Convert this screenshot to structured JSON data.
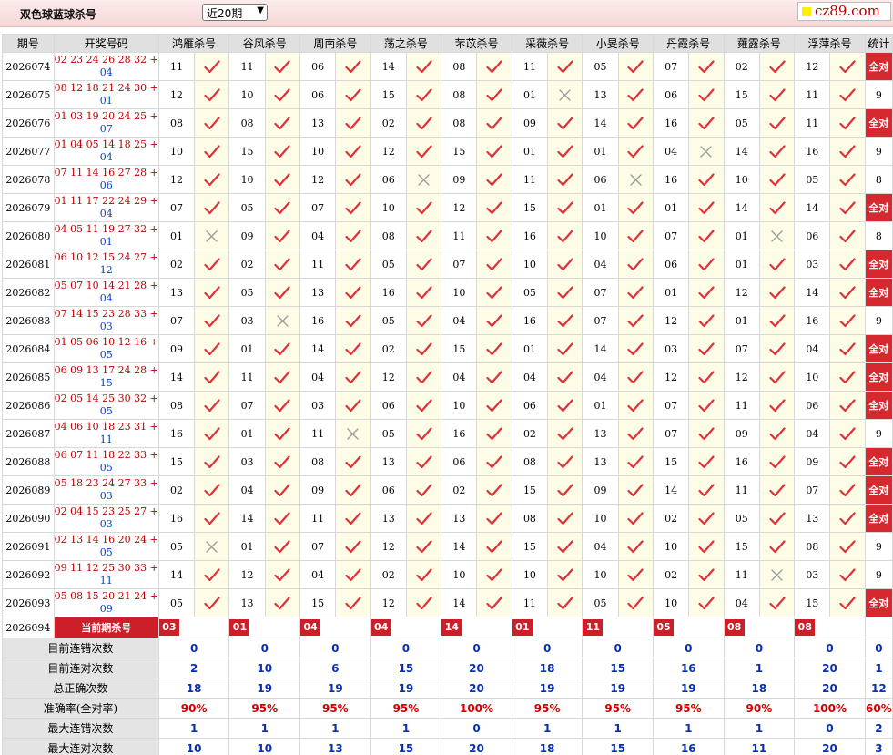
{
  "header": {
    "title": "双色球蓝球杀号",
    "range_select": "近20期",
    "logo": "cz89.com"
  },
  "table": {
    "columns": [
      "期号",
      "开奖号码",
      "鸿雁杀号",
      "谷风杀号",
      "周南杀号",
      "荡之杀号",
      "芣苡杀号",
      "采薇杀号",
      "小旻杀号",
      "丹霞杀号",
      "蕹露杀号",
      "浮萍杀号",
      "统计"
    ],
    "all_right_label": "全对",
    "rows": [
      {
        "period": "2026074",
        "red": "02 23 24 26 28 32 +",
        "blue": "04",
        "kills": [
          [
            "11",
            1
          ],
          [
            "11",
            1
          ],
          [
            "06",
            1
          ],
          [
            "14",
            1
          ],
          [
            "08",
            1
          ],
          [
            "11",
            1
          ],
          [
            "05",
            1
          ],
          [
            "07",
            1
          ],
          [
            "02",
            1
          ],
          [
            "12",
            1
          ]
        ],
        "stat": "全对"
      },
      {
        "period": "2026075",
        "red": "08 12 18 21 24 30 +",
        "blue": "01",
        "kills": [
          [
            "12",
            1
          ],
          [
            "10",
            1
          ],
          [
            "06",
            1
          ],
          [
            "15",
            1
          ],
          [
            "08",
            1
          ],
          [
            "01",
            0
          ],
          [
            "13",
            1
          ],
          [
            "06",
            1
          ],
          [
            "15",
            1
          ],
          [
            "11",
            1
          ]
        ],
        "stat": "9"
      },
      {
        "period": "2026076",
        "red": "01 03 19 20 24 25 +",
        "blue": "07",
        "kills": [
          [
            "08",
            1
          ],
          [
            "08",
            1
          ],
          [
            "13",
            1
          ],
          [
            "02",
            1
          ],
          [
            "08",
            1
          ],
          [
            "09",
            1
          ],
          [
            "14",
            1
          ],
          [
            "16",
            1
          ],
          [
            "05",
            1
          ],
          [
            "11",
            1
          ]
        ],
        "stat": "全对"
      },
      {
        "period": "2026077",
        "red": "01 04 05 14 18 25 +",
        "blue": "04",
        "kills": [
          [
            "10",
            1
          ],
          [
            "15",
            1
          ],
          [
            "10",
            1
          ],
          [
            "12",
            1
          ],
          [
            "15",
            1
          ],
          [
            "01",
            1
          ],
          [
            "01",
            1
          ],
          [
            "04",
            0
          ],
          [
            "14",
            1
          ],
          [
            "16",
            1
          ]
        ],
        "stat": "9"
      },
      {
        "period": "2026078",
        "red": "07 11 14 16 27 28 +",
        "blue": "06",
        "kills": [
          [
            "12",
            1
          ],
          [
            "10",
            1
          ],
          [
            "12",
            1
          ],
          [
            "06",
            0
          ],
          [
            "09",
            1
          ],
          [
            "11",
            1
          ],
          [
            "06",
            0
          ],
          [
            "16",
            1
          ],
          [
            "10",
            1
          ],
          [
            "05",
            1
          ]
        ],
        "stat": "8"
      },
      {
        "period": "2026079",
        "red": "01 11 17 22 24 29 +",
        "blue": "04",
        "kills": [
          [
            "07",
            1
          ],
          [
            "05",
            1
          ],
          [
            "07",
            1
          ],
          [
            "10",
            1
          ],
          [
            "12",
            1
          ],
          [
            "15",
            1
          ],
          [
            "01",
            1
          ],
          [
            "01",
            1
          ],
          [
            "14",
            1
          ],
          [
            "14",
            1
          ]
        ],
        "stat": "全对"
      },
      {
        "period": "2026080",
        "red": "04 05 11 19 27 32 +",
        "blue": "01",
        "kills": [
          [
            "01",
            0
          ],
          [
            "09",
            1
          ],
          [
            "04",
            1
          ],
          [
            "08",
            1
          ],
          [
            "11",
            1
          ],
          [
            "16",
            1
          ],
          [
            "10",
            1
          ],
          [
            "07",
            1
          ],
          [
            "01",
            0
          ],
          [
            "06",
            1
          ]
        ],
        "stat": "8"
      },
      {
        "period": "2026081",
        "red": "06 10 12 15 24 27 +",
        "blue": "12",
        "kills": [
          [
            "02",
            1
          ],
          [
            "02",
            1
          ],
          [
            "11",
            1
          ],
          [
            "05",
            1
          ],
          [
            "07",
            1
          ],
          [
            "10",
            1
          ],
          [
            "04",
            1
          ],
          [
            "06",
            1
          ],
          [
            "01",
            1
          ],
          [
            "03",
            1
          ]
        ],
        "stat": "全对"
      },
      {
        "period": "2026082",
        "red": "05 07 10 14 21 28 +",
        "blue": "04",
        "kills": [
          [
            "13",
            1
          ],
          [
            "05",
            1
          ],
          [
            "13",
            1
          ],
          [
            "16",
            1
          ],
          [
            "10",
            1
          ],
          [
            "05",
            1
          ],
          [
            "07",
            1
          ],
          [
            "01",
            1
          ],
          [
            "12",
            1
          ],
          [
            "14",
            1
          ]
        ],
        "stat": "全对"
      },
      {
        "period": "2026083",
        "red": "07 14 15 23 28 33 +",
        "blue": "03",
        "kills": [
          [
            "07",
            1
          ],
          [
            "03",
            0
          ],
          [
            "16",
            1
          ],
          [
            "05",
            1
          ],
          [
            "04",
            1
          ],
          [
            "16",
            1
          ],
          [
            "07",
            1
          ],
          [
            "12",
            1
          ],
          [
            "01",
            1
          ],
          [
            "16",
            1
          ]
        ],
        "stat": "9"
      },
      {
        "period": "2026084",
        "red": "01 05 06 10 12 16 +",
        "blue": "05",
        "kills": [
          [
            "09",
            1
          ],
          [
            "01",
            1
          ],
          [
            "14",
            1
          ],
          [
            "02",
            1
          ],
          [
            "15",
            1
          ],
          [
            "01",
            1
          ],
          [
            "14",
            1
          ],
          [
            "03",
            1
          ],
          [
            "07",
            1
          ],
          [
            "04",
            1
          ]
        ],
        "stat": "全对"
      },
      {
        "period": "2026085",
        "red": "06 09 13 17 24 28 +",
        "blue": "15",
        "kills": [
          [
            "14",
            1
          ],
          [
            "11",
            1
          ],
          [
            "04",
            1
          ],
          [
            "12",
            1
          ],
          [
            "04",
            1
          ],
          [
            "04",
            1
          ],
          [
            "04",
            1
          ],
          [
            "12",
            1
          ],
          [
            "12",
            1
          ],
          [
            "10",
            1
          ]
        ],
        "stat": "全对"
      },
      {
        "period": "2026086",
        "red": "02 05 14 25 30 32 +",
        "blue": "05",
        "kills": [
          [
            "08",
            1
          ],
          [
            "07",
            1
          ],
          [
            "03",
            1
          ],
          [
            "06",
            1
          ],
          [
            "10",
            1
          ],
          [
            "06",
            1
          ],
          [
            "01",
            1
          ],
          [
            "07",
            1
          ],
          [
            "11",
            1
          ],
          [
            "06",
            1
          ]
        ],
        "stat": "全对"
      },
      {
        "period": "2026087",
        "red": "04 06 10 18 23 31 +",
        "blue": "11",
        "kills": [
          [
            "16",
            1
          ],
          [
            "01",
            1
          ],
          [
            "11",
            0
          ],
          [
            "05",
            1
          ],
          [
            "16",
            1
          ],
          [
            "02",
            1
          ],
          [
            "13",
            1
          ],
          [
            "07",
            1
          ],
          [
            "09",
            1
          ],
          [
            "04",
            1
          ]
        ],
        "stat": "9"
      },
      {
        "period": "2026088",
        "red": "06 07 11 18 22 33 +",
        "blue": "05",
        "kills": [
          [
            "15",
            1
          ],
          [
            "03",
            1
          ],
          [
            "08",
            1
          ],
          [
            "13",
            1
          ],
          [
            "06",
            1
          ],
          [
            "08",
            1
          ],
          [
            "13",
            1
          ],
          [
            "15",
            1
          ],
          [
            "16",
            1
          ],
          [
            "09",
            1
          ]
        ],
        "stat": "全对"
      },
      {
        "period": "2026089",
        "red": "05 18 23 24 27 33 +",
        "blue": "03",
        "kills": [
          [
            "02",
            1
          ],
          [
            "04",
            1
          ],
          [
            "09",
            1
          ],
          [
            "06",
            1
          ],
          [
            "02",
            1
          ],
          [
            "15",
            1
          ],
          [
            "09",
            1
          ],
          [
            "14",
            1
          ],
          [
            "11",
            1
          ],
          [
            "07",
            1
          ]
        ],
        "stat": "全对"
      },
      {
        "period": "2026090",
        "red": "02 04 15 23 25 27 +",
        "blue": "03",
        "kills": [
          [
            "16",
            1
          ],
          [
            "14",
            1
          ],
          [
            "11",
            1
          ],
          [
            "13",
            1
          ],
          [
            "13",
            1
          ],
          [
            "08",
            1
          ],
          [
            "10",
            1
          ],
          [
            "02",
            1
          ],
          [
            "05",
            1
          ],
          [
            "13",
            1
          ]
        ],
        "stat": "全对"
      },
      {
        "period": "2026091",
        "red": "02 13 14 16 20 24 +",
        "blue": "05",
        "kills": [
          [
            "05",
            0
          ],
          [
            "01",
            1
          ],
          [
            "07",
            1
          ],
          [
            "12",
            1
          ],
          [
            "14",
            1
          ],
          [
            "15",
            1
          ],
          [
            "04",
            1
          ],
          [
            "10",
            1
          ],
          [
            "15",
            1
          ],
          [
            "08",
            1
          ]
        ],
        "stat": "9"
      },
      {
        "period": "2026092",
        "red": "09 11 12 25 30 33 +",
        "blue": "11",
        "kills": [
          [
            "14",
            1
          ],
          [
            "12",
            1
          ],
          [
            "04",
            1
          ],
          [
            "02",
            1
          ],
          [
            "10",
            1
          ],
          [
            "10",
            1
          ],
          [
            "10",
            1
          ],
          [
            "02",
            1
          ],
          [
            "11",
            0
          ],
          [
            "03",
            1
          ]
        ],
        "stat": "9"
      },
      {
        "period": "2026093",
        "red": "05 08 15 20 21 24 +",
        "blue": "09",
        "kills": [
          [
            "05",
            1
          ],
          [
            "13",
            1
          ],
          [
            "15",
            1
          ],
          [
            "12",
            1
          ],
          [
            "14",
            1
          ],
          [
            "11",
            1
          ],
          [
            "05",
            1
          ],
          [
            "10",
            1
          ],
          [
            "04",
            1
          ],
          [
            "15",
            1
          ]
        ],
        "stat": "全对"
      }
    ],
    "current": {
      "period": "2026094",
      "label": "当前期杀号",
      "kills": [
        "03",
        "01",
        "04",
        "04",
        "14",
        "01",
        "11",
        "05",
        "08",
        "08"
      ]
    },
    "stats": [
      {
        "label": "目前连错次数",
        "values": [
          "0",
          "0",
          "0",
          "0",
          "0",
          "0",
          "0",
          "0",
          "0",
          "0",
          "0"
        ],
        "pct": false
      },
      {
        "label": "目前连对次数",
        "values": [
          "2",
          "10",
          "6",
          "15",
          "20",
          "18",
          "15",
          "16",
          "1",
          "20",
          "1"
        ],
        "pct": false
      },
      {
        "label": "总正确次数",
        "values": [
          "18",
          "19",
          "19",
          "19",
          "20",
          "19",
          "19",
          "19",
          "18",
          "20",
          "12"
        ],
        "pct": false
      },
      {
        "label": "准确率(全对率)",
        "values": [
          "90%",
          "95%",
          "95%",
          "95%",
          "100%",
          "95%",
          "95%",
          "95%",
          "90%",
          "100%",
          "60%"
        ],
        "pct": true
      },
      {
        "label": "最大连错次数",
        "values": [
          "1",
          "1",
          "1",
          "1",
          "0",
          "1",
          "1",
          "1",
          "1",
          "0",
          "2"
        ],
        "pct": false
      },
      {
        "label": "最大连对次数",
        "values": [
          "10",
          "10",
          "13",
          "15",
          "20",
          "18",
          "15",
          "16",
          "11",
          "20",
          "3"
        ],
        "pct": false
      }
    ]
  },
  "colors": {
    "accent_red": "#cc1f2a",
    "check_red": "#e0303a",
    "cross_gray": "#9a9a9a",
    "stat_blue": "#0a2fae"
  }
}
